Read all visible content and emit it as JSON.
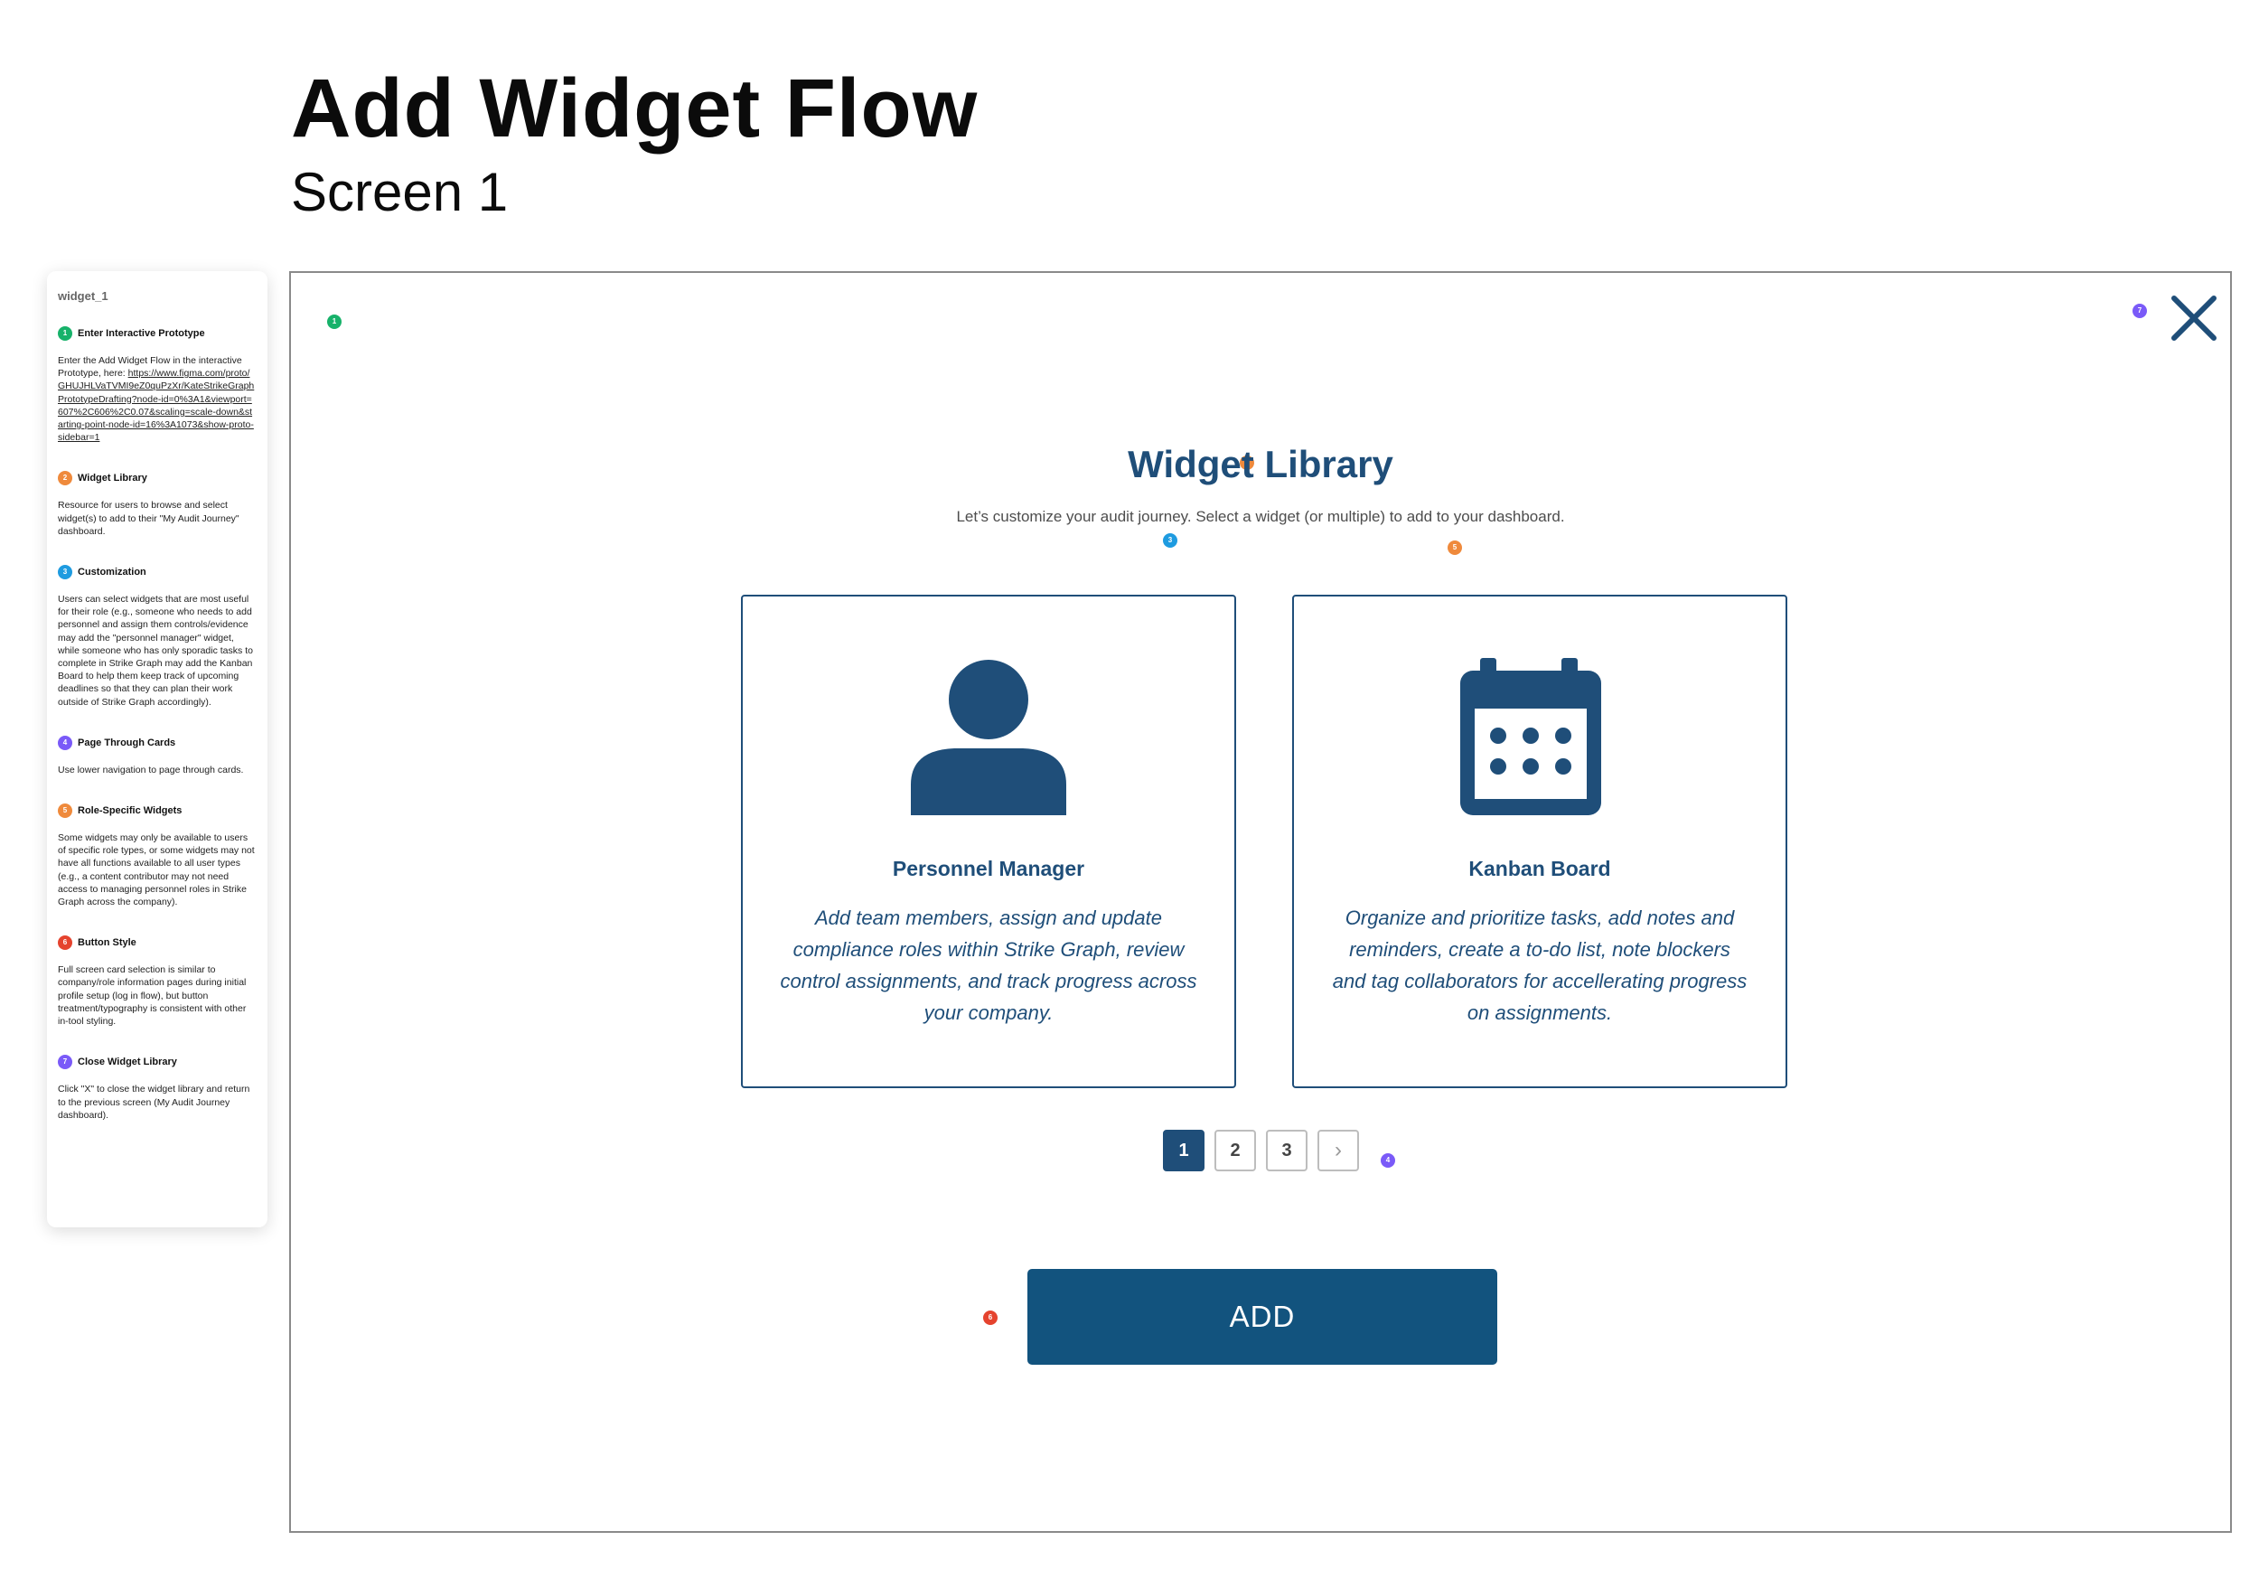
{
  "page": {
    "title": "Add Widget Flow",
    "subtitle": "Screen 1"
  },
  "colors": {
    "primary": "#1f4e79",
    "button": "#12537e",
    "green": "#17b26a",
    "orange": "#ef8a3c",
    "blue": "#1e9be0",
    "purple": "#7a5af8",
    "red": "#e5432e"
  },
  "notes": {
    "header": "widget_1",
    "items": [
      {
        "num": "1",
        "color": "#17b26a",
        "title": "Enter Interactive Prototype",
        "body": "Enter the Add Widget Flow in the interactive Prototype, here: ",
        "link": "https://www.figma.com/proto/GHUJHLVaTVMI9eZ0quPzXr/KateStrikeGraphPrototypeDrafting?node-id=0%3A1&viewport=607%2C606%2C0.07&scaling=scale-down&starting-point-node-id=16%3A1073&show-proto-sidebar=1"
      },
      {
        "num": "2",
        "color": "#ef8a3c",
        "title": "Widget Library",
        "body": "Resource for users to browse and select widget(s) to add to their \"My Audit Journey\" dashboard."
      },
      {
        "num": "3",
        "color": "#1e9be0",
        "title": "Customization",
        "body": "Users can select widgets that are most useful for their role (e.g., someone who needs to add personnel and assign them controls/evidence may add the \"personnel manager\" widget, while someone who has only sporadic tasks to complete in Strike Graph may add the Kanban Board to help them keep track of upcoming deadlines so that they can plan their work outside of Strike Graph accordingly)."
      },
      {
        "num": "4",
        "color": "#7a5af8",
        "title": "Page Through Cards",
        "body": "Use lower navigation to page through cards."
      },
      {
        "num": "5",
        "color": "#ef8a3c",
        "title": "Role-Specific Widgets",
        "body": "Some widgets may only be available to users of specific role types, or some widgets may not have all functions available to all user types (e.g., a content contributor may not need access to managing personnel roles in Strike Graph across the company)."
      },
      {
        "num": "6",
        "color": "#e5432e",
        "title": "Button Style",
        "body": "Full screen card selection is similar to company/role information pages during initial profile setup (log in flow), but button treatment/typography is consistent with other in-tool styling."
      },
      {
        "num": "7",
        "color": "#7a5af8",
        "title": "Close Widget Library",
        "body": "Click \"X\" to close the widget library and return to the previous screen (My Audit Journey dashboard)."
      }
    ]
  },
  "screen": {
    "markers": [
      "1",
      "2",
      "3",
      "4",
      "5",
      "6",
      "7"
    ],
    "title": "Widget Library",
    "subtitle": "Let’s customize your audit journey. Select a widget (or multiple) to add to your dashboard.",
    "cards": [
      {
        "name": "Personnel Manager",
        "icon": "person-icon",
        "desc": "Add team members, assign and update compliance roles within Strike Graph, review control assignments, and track progress across your company."
      },
      {
        "name": "Kanban Board",
        "icon": "calendar-icon",
        "desc": "Organize and prioritize tasks, add notes and reminders, create a to-do list, note blockers and tag collaborators for accellerating progress on assignments."
      }
    ],
    "pagination": {
      "pages": [
        "1",
        "2",
        "3"
      ],
      "current": "1",
      "next_icon": "chevron-right-icon",
      "next": "›"
    },
    "add_button": "ADD",
    "close_icon": "close-icon"
  }
}
